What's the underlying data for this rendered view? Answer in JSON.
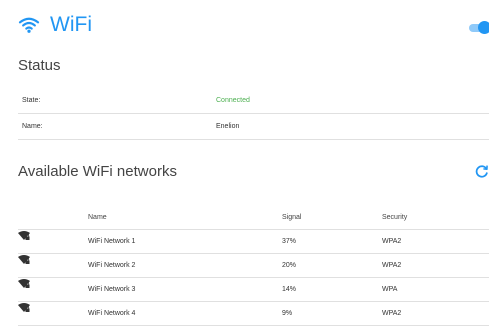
{
  "header": {
    "title": "WiFi",
    "icon": "wifi-icon",
    "accent": "#2196f3",
    "enabled": true
  },
  "status": {
    "title": "Status",
    "rows": [
      {
        "label": "State:",
        "value": "Connected",
        "value_color": "#4caf50"
      },
      {
        "label": "Name:",
        "value": "Enelion"
      }
    ]
  },
  "networks": {
    "title": "Available WiFi networks",
    "refresh_icon": "refresh-icon",
    "columns": {
      "name": "Name",
      "signal": "Signal",
      "security": "Security"
    },
    "rows": [
      {
        "icon": "wifi-secured-icon",
        "name": "WiFi Network 1",
        "signal": "37%",
        "security": "WPA2"
      },
      {
        "icon": "wifi-secured-icon",
        "name": "WiFi Network 2",
        "signal": "20%",
        "security": "WPA2"
      },
      {
        "icon": "wifi-secured-icon",
        "name": "WiFi Network 3",
        "signal": "14%",
        "security": "WPA"
      },
      {
        "icon": "wifi-secured-icon",
        "name": "WiFi Network 4",
        "signal": "9%",
        "security": "WPA2"
      }
    ]
  }
}
